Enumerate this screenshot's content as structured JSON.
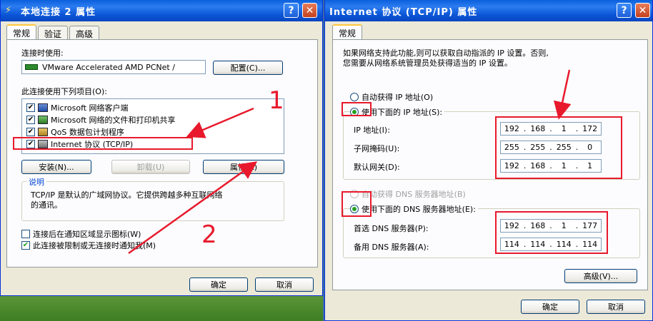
{
  "left": {
    "title": "本地连接 2 属性",
    "tabs": [
      "常规",
      "验证",
      "高级"
    ],
    "connect_using_label": "连接时使用:",
    "adapter_name": "VMware Accelerated AMD PCNet /",
    "configure_button": "配置(C)...",
    "items_label": "此连接使用下列项目(O):",
    "items": [
      {
        "label": "Microsoft 网络客户端",
        "checked": true
      },
      {
        "label": "Microsoft 网络的文件和打印机共享",
        "checked": true
      },
      {
        "label": "QoS 数据包计划程序",
        "checked": true
      },
      {
        "label": "Internet 协议 (TCP/IP)",
        "checked": true
      }
    ],
    "install_button": "安装(N)...",
    "uninstall_button": "卸载(U)",
    "properties_button": "属性(R)",
    "description_title": "说明",
    "description_text_1": "TCP/IP 是默认的广域网协议。它提供跨越多种互联网络",
    "description_text_2": "的通讯。",
    "show_icon_label": "连接后在通知区域显示图标(W)",
    "notify_label": "此连接被限制或无连接时通知我(M)",
    "ok_button": "确定",
    "cancel_button": "取消"
  },
  "right": {
    "title": "Internet 协议 (TCP/IP) 属性",
    "tab": "常规",
    "intro_1": "如果网络支持此功能,则可以获取自动指派的 IP 设置。否则,",
    "intro_2": "您需要从网络系统管理员处获得适当的 IP 设置。",
    "auto_ip_label": "自动获得 IP 地址(O)",
    "manual_ip_label": "使用下面的 IP 地址(S):",
    "ip_label": "IP 地址(I):",
    "mask_label": "子网掩码(U):",
    "gateway_label": "默认网关(D):",
    "ip": [
      "192",
      "168",
      "1",
      "172"
    ],
    "mask": [
      "255",
      "255",
      "255",
      "0"
    ],
    "gateway": [
      "192",
      "168",
      "1",
      "1"
    ],
    "auto_dns_label": "自动获得 DNS 服务器地址(B)",
    "manual_dns_label": "使用下面的 DNS 服务器地址(E):",
    "dns1_label": "首选 DNS 服务器(P):",
    "dns2_label": "备用 DNS 服务器(A):",
    "dns1": [
      "192",
      "168",
      "1",
      "177"
    ],
    "dns2": [
      "114",
      "114",
      "114",
      "114"
    ],
    "advanced_button": "高级(V)...",
    "ok_button": "确定",
    "cancel_button": "取消"
  },
  "annotations": {
    "number_1": "1",
    "number_2": "2"
  },
  "colors": {
    "annotation_red": "#e8192c",
    "titlebar_blue": "#0a5fdc"
  }
}
